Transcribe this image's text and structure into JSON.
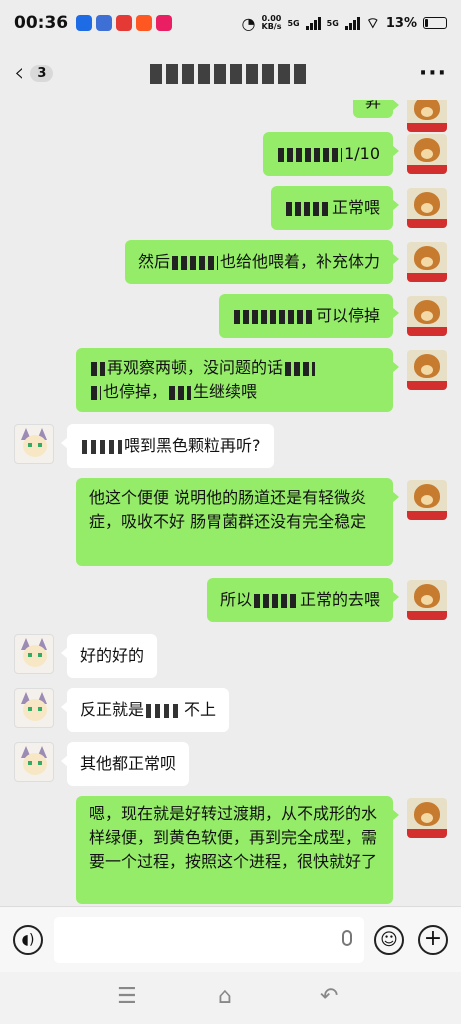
{
  "status_bar": {
    "time": "00:36",
    "net_speed": "0.00",
    "net_unit": "KB/s",
    "signal1": "5G",
    "signal2": "5G",
    "battery": "13%",
    "battery_level": 0.13
  },
  "nav": {
    "back_icon": "chevron-left-icon",
    "unread_count": "3",
    "more_icon": "more-dots-icon"
  },
  "messages": [
    {
      "side": "me",
      "text": "1/10",
      "prefix_redacted": true
    },
    {
      "side": "me",
      "text": "正常喂",
      "prefix_redacted": true
    },
    {
      "side": "me",
      "text": "然后",
      "tail": "也给他喂着，补充体力"
    },
    {
      "side": "me",
      "text": "可以停掉",
      "prefix_redacted": true
    },
    {
      "side": "me",
      "line1": "再观察两顿，没问题的话",
      "line2a": "也停掉，",
      "line2b": "生继续喂"
    },
    {
      "side": "them",
      "text": "喂到黑色颗粒再听?"
    },
    {
      "side": "me",
      "text": "他这个便便 说明他的肠道还是有轻微炎症，吸收不好 肠胃菌群还没有完全稳定"
    },
    {
      "side": "me",
      "text": "所以",
      "tail": "正常的去喂"
    },
    {
      "side": "them",
      "text": "好的好的"
    },
    {
      "side": "them",
      "text": "反正就是",
      "tail": "不上"
    },
    {
      "side": "them",
      "text": "其他都正常呗"
    },
    {
      "side": "me",
      "text": "嗯，现在就是好转过渡期，从不成形的水样绿便，到黄色软便，再到完全成型，需要一个过程，按照这个进程，很快就好了"
    }
  ],
  "top_partial_text": "昇",
  "input": {
    "voice_icon": "voice-icon",
    "mic_icon": "mic-icon",
    "emoji_icon": "emoji-icon",
    "plus_icon": "plus-icon"
  },
  "colors": {
    "my_bubble": "#95ec69",
    "their_bubble": "#ffffff",
    "background": "#ededed"
  }
}
